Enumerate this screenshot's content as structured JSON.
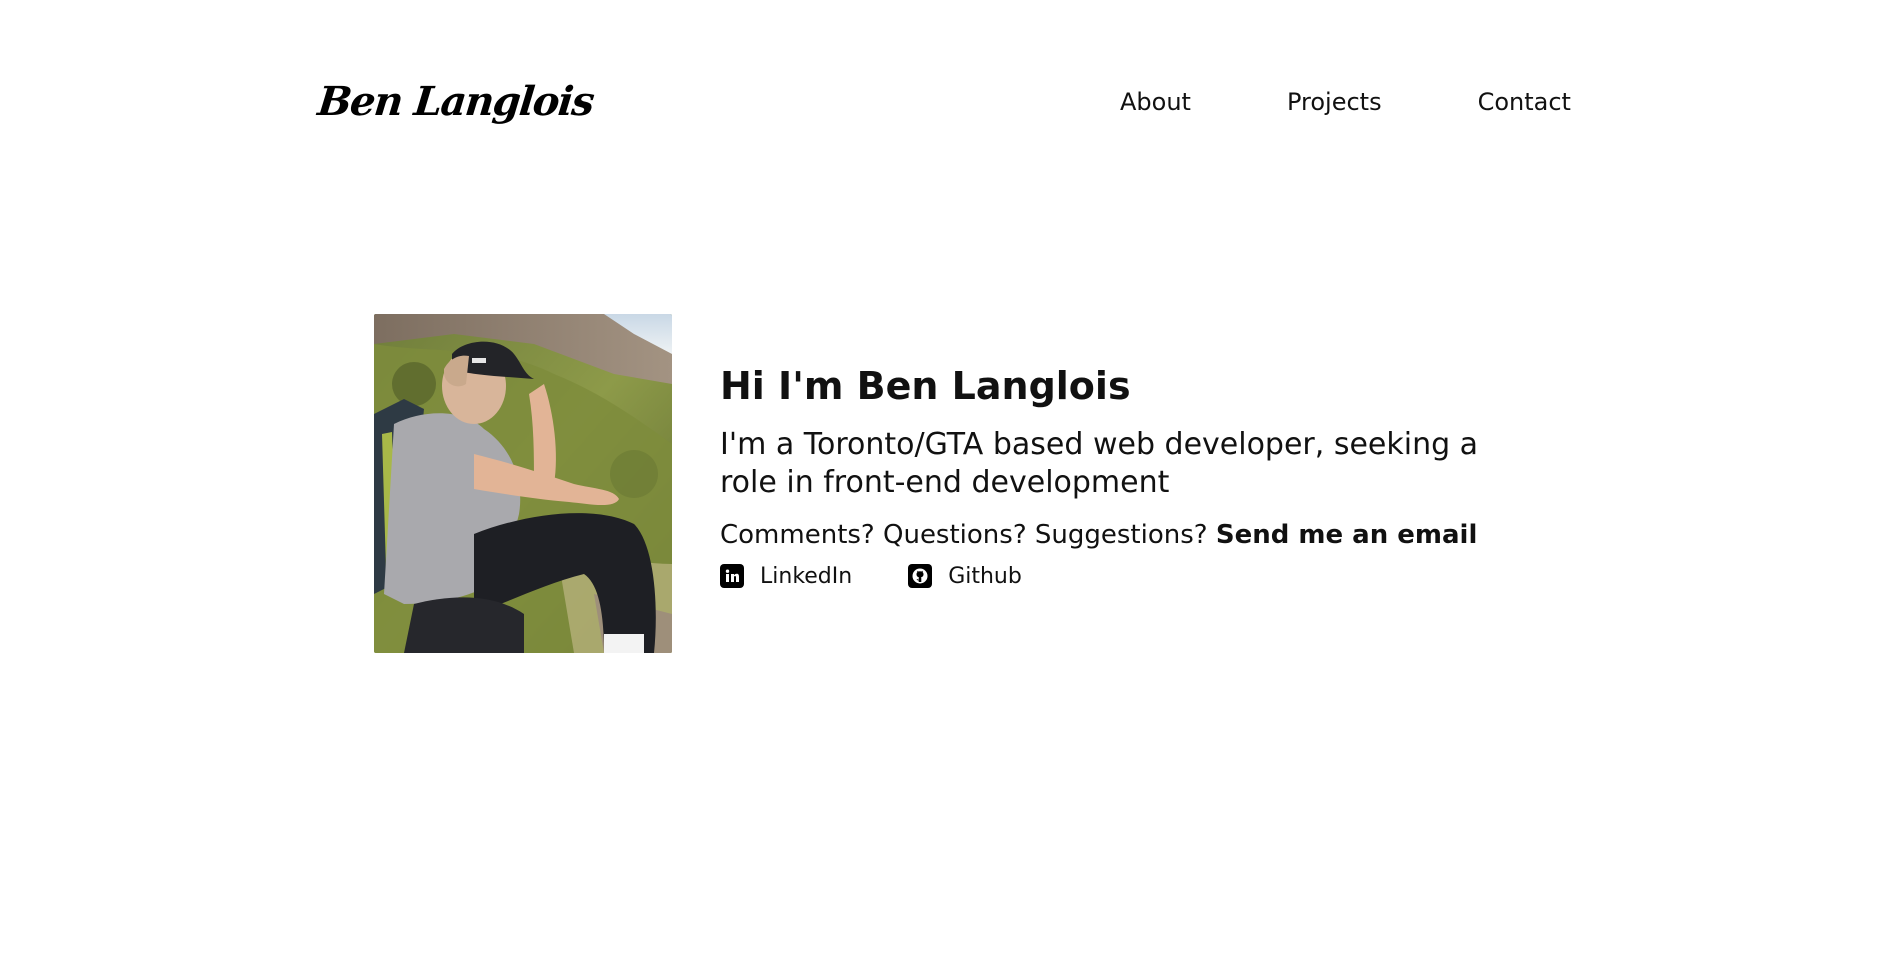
{
  "header": {
    "logo": "Ben Langlois",
    "nav": {
      "about": "About",
      "projects": "Projects",
      "contact": "Contact"
    }
  },
  "hero": {
    "greeting": "Hi I'm Ben Langlois",
    "tagline": "I'm a Toronto/GTA based web developer, seeking a role in front-end development",
    "contact_prefix": "Comments? Questions? Suggestions?",
    "email_link": "Send me an email",
    "social": {
      "linkedin_label": "LinkedIn",
      "linkedin_icon": "linkedin-icon",
      "github_label": "Github",
      "github_icon": "github-icon"
    }
  },
  "colors": {
    "text": "#111111",
    "background": "#ffffff"
  }
}
